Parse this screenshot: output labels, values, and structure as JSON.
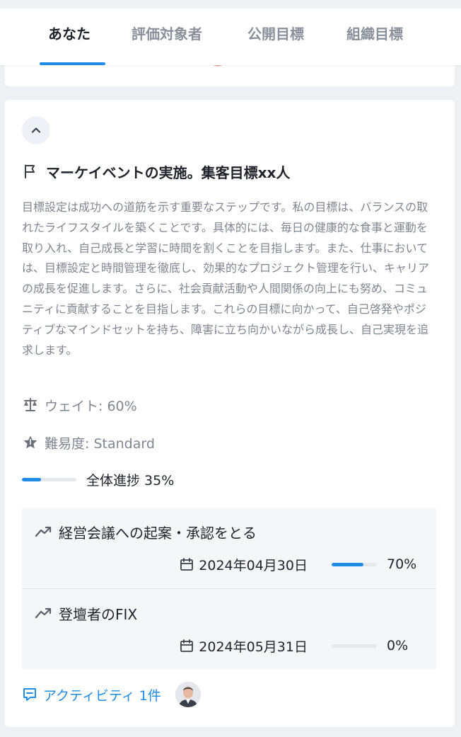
{
  "tabs": [
    {
      "label": "あなた",
      "active": true
    },
    {
      "label": "評価対象者",
      "active": false
    },
    {
      "label": "公開目標",
      "active": false
    },
    {
      "label": "組織目標",
      "active": false
    }
  ],
  "goal": {
    "title": "マーケイベントの実施。集客目標xx人",
    "description": "目標設定は成功への道筋を示す重要なステップです。私の目標は、バランスの取れたライフスタイルを築くことです。具体的には、毎日の健康的な食事と運動を取り入れ、自己成長と学習に時間を割くことを目指します。また、仕事においては、目標設定と時間管理を徹底し、効果的なプロジェクト管理を行い、キャリアの成長を促進します。さらに、社会貢献活動や人間関係の向上にも努め、コミュニティに貢献することを目指します。これらの目標に向かって、自己啓発やポジティブなマインドセットを持ち、障害に立ち向かいながら成長し、自己実現を追求します。",
    "weight_text": "ウェイト: 60%",
    "difficulty_text": "難易度: Standard",
    "progress_text": "全体進捗 35%",
    "progress_value": 0.35
  },
  "key_results": [
    {
      "title": "経営会議への起案・承認をとる",
      "date": "2024年04月30日",
      "progress_text": "70%",
      "progress_value": 0.7
    },
    {
      "title": "登壇者のFIX",
      "date": "2024年05月31日",
      "progress_text": "0%",
      "progress_value": 0
    }
  ],
  "activity": {
    "label": "アクティビティ 1件"
  },
  "colors": {
    "accent": "#1f8ce6",
    "muted_text": "#80868f",
    "track": "#e6e8ec"
  },
  "icons": {
    "collapse": "chevron-up-icon",
    "goal": "flag-icon",
    "weight": "scale-icon",
    "difficulty": "star-icon",
    "key_result": "trend-up-icon",
    "due_date": "calendar-icon",
    "activity": "comment-icon"
  }
}
